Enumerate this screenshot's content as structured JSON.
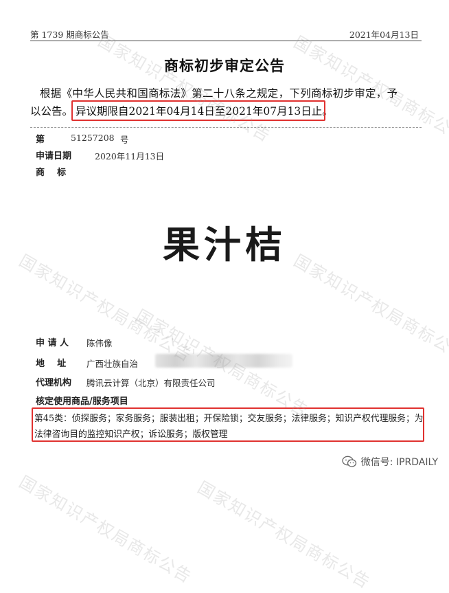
{
  "header": {
    "issue": "第 1739 期商标公告",
    "date": "2021年04月13日"
  },
  "title": "商标初步审定公告",
  "intro": {
    "line1": "根据《中华人民共和国商标法》第二十八条之规定，下列商标初步审定，予",
    "line2_prefix": "以公告。",
    "objection_period": "异议期限自2021年04月14日至2021年07月13日止。"
  },
  "fields": {
    "number_label": "第",
    "number_value": "51257208",
    "number_suffix": "号",
    "date_label": "申请日期",
    "date_value": "2020年11月13日",
    "mark_label": "商    标",
    "applicant_label": "申 请 人",
    "applicant_value": "陈伟像",
    "address_label": "地    址",
    "address_value": "广西壮族自治",
    "agent_label": "代理机构",
    "agent_value": "腾讯云计算（北京）有限责任公司",
    "goods_label": "核定使用商品/服务项目"
  },
  "trademark": "果汁桔",
  "services": "第45类：侦探服务；家务服务；服装出租；开保险锁；交友服务；法律服务；知识产权代理服务；为法律咨询目的监控知识产权；诉讼服务；版权管理",
  "watermark": "国家知识产权局商标公告",
  "wechat": {
    "label": "微信号: IPRDAILY"
  },
  "colors": {
    "highlight": "#e0312f",
    "watermark": "#969696"
  }
}
